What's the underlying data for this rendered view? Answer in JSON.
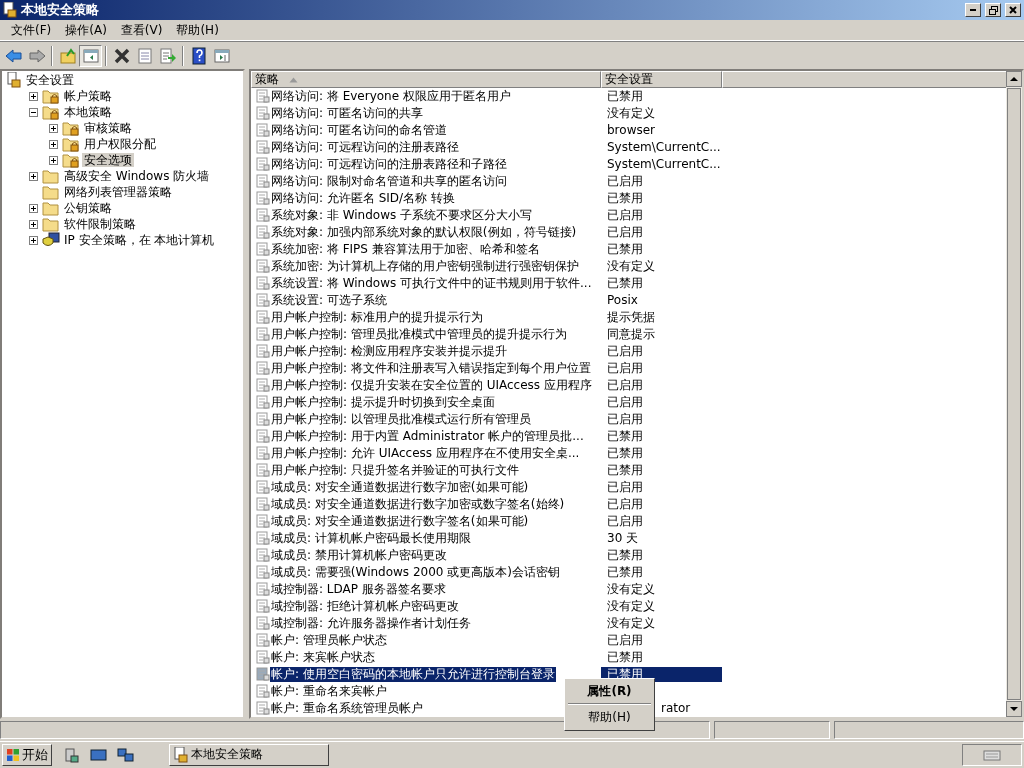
{
  "window": {
    "title": "本地安全策略"
  },
  "menu": [
    "文件(F)",
    "操作(A)",
    "查看(V)",
    "帮助(H)"
  ],
  "toolbar": [
    {
      "kind": "back"
    },
    {
      "kind": "forward"
    },
    {
      "kind": "sep"
    },
    {
      "kind": "up"
    },
    {
      "kind": "tree",
      "selected": true
    },
    {
      "kind": "sep"
    },
    {
      "kind": "delete"
    },
    {
      "kind": "properties"
    },
    {
      "kind": "export"
    },
    {
      "kind": "sep"
    },
    {
      "kind": "help"
    },
    {
      "kind": "pane"
    }
  ],
  "tree": [
    {
      "label": "安全设置",
      "kind": "root",
      "expandable": false,
      "selected": false,
      "children": [
        {
          "label": "帐户策略",
          "kind": "lockfolder",
          "expandable": true,
          "expanded": false,
          "selected": false
        },
        {
          "label": "本地策略",
          "kind": "lockfolder",
          "expandable": true,
          "expanded": true,
          "selected": false,
          "children": [
            {
              "label": "审核策略",
              "kind": "lockfolder",
              "expandable": true,
              "expanded": false,
              "selected": false
            },
            {
              "label": "用户权限分配",
              "kind": "lockfolder",
              "expandable": true,
              "expanded": false,
              "selected": false
            },
            {
              "label": "安全选项",
              "kind": "lockfolder",
              "expandable": true,
              "expanded": false,
              "selected": true
            }
          ]
        },
        {
          "label": "高级安全 Windows 防火墙",
          "kind": "folder",
          "expandable": true,
          "expanded": false,
          "selected": false
        },
        {
          "label": "网络列表管理器策略",
          "kind": "folder",
          "expandable": false,
          "selected": false
        },
        {
          "label": "公钥策略",
          "kind": "folder",
          "expandable": true,
          "expanded": false,
          "selected": false
        },
        {
          "label": "软件限制策略",
          "kind": "folder",
          "expandable": true,
          "expanded": false,
          "selected": false
        },
        {
          "label": "IP 安全策略，在 本地计算机",
          "kind": "computer",
          "expandable": true,
          "expanded": false,
          "selected": false
        }
      ]
    }
  ],
  "table": {
    "columns": [
      {
        "label": "策略",
        "sorted": true
      },
      {
        "label": "安全设置",
        "sorted": false
      }
    ],
    "rows": [
      {
        "policy": "网络访问: 将 Everyone 权限应用于匿名用户",
        "setting": "已禁用",
        "selected": false
      },
      {
        "policy": "网络访问: 可匿名访问的共享",
        "setting": "没有定义",
        "selected": false
      },
      {
        "policy": "网络访问: 可匿名访问的命名管道",
        "setting": "browser",
        "selected": false
      },
      {
        "policy": "网络访问: 可远程访问的注册表路径",
        "setting": "System\\CurrentC...",
        "selected": false
      },
      {
        "policy": "网络访问: 可远程访问的注册表路径和子路径",
        "setting": "System\\CurrentC...",
        "selected": false
      },
      {
        "policy": "网络访问: 限制对命名管道和共享的匿名访问",
        "setting": "已启用",
        "selected": false
      },
      {
        "policy": "网络访问: 允许匿名 SID/名称 转换",
        "setting": "已禁用",
        "selected": false
      },
      {
        "policy": "系统对象: 非 Windows 子系统不要求区分大小写",
        "setting": "已启用",
        "selected": false
      },
      {
        "policy": "系统对象: 加强内部系统对象的默认权限(例如，符号链接)",
        "setting": "已启用",
        "selected": false
      },
      {
        "policy": "系统加密: 将 FIPS 兼容算法用于加密、哈希和签名",
        "setting": "已禁用",
        "selected": false
      },
      {
        "policy": "系统加密: 为计算机上存储的用户密钥强制进行强密钥保护",
        "setting": "没有定义",
        "selected": false
      },
      {
        "policy": "系统设置: 将 Windows 可执行文件中的证书规则用于软件...",
        "setting": "已禁用",
        "selected": false
      },
      {
        "policy": "系统设置: 可选子系统",
        "setting": "Posix",
        "selected": false
      },
      {
        "policy": "用户帐户控制: 标准用户的提升提示行为",
        "setting": "提示凭据",
        "selected": false
      },
      {
        "policy": "用户帐户控制: 管理员批准模式中管理员的提升提示行为",
        "setting": "同意提示",
        "selected": false
      },
      {
        "policy": "用户帐户控制: 检测应用程序安装并提示提升",
        "setting": "已启用",
        "selected": false
      },
      {
        "policy": "用户帐户控制: 将文件和注册表写入错误指定到每个用户位置",
        "setting": "已启用",
        "selected": false
      },
      {
        "policy": "用户帐户控制: 仅提升安装在安全位置的 UIAccess 应用程序",
        "setting": "已启用",
        "selected": false
      },
      {
        "policy": "用户帐户控制: 提示提升时切换到安全桌面",
        "setting": "已启用",
        "selected": false
      },
      {
        "policy": "用户帐户控制: 以管理员批准模式运行所有管理员",
        "setting": "已启用",
        "selected": false
      },
      {
        "policy": "用户帐户控制: 用于内置 Administrator 帐户的管理员批...",
        "setting": "已禁用",
        "selected": false
      },
      {
        "policy": "用户帐户控制: 允许 UIAccess 应用程序在不使用安全桌...",
        "setting": "已禁用",
        "selected": false
      },
      {
        "policy": "用户帐户控制: 只提升签名并验证的可执行文件",
        "setting": "已禁用",
        "selected": false
      },
      {
        "policy": "域成员: 对安全通道数据进行数字加密(如果可能)",
        "setting": "已启用",
        "selected": false
      },
      {
        "policy": "域成员: 对安全通道数据进行数字加密或数字签名(始终)",
        "setting": "已启用",
        "selected": false
      },
      {
        "policy": "域成员: 对安全通道数据进行数字签名(如果可能)",
        "setting": "已启用",
        "selected": false
      },
      {
        "policy": "域成员: 计算机帐户密码最长使用期限",
        "setting": "30 天",
        "selected": false
      },
      {
        "policy": "域成员: 禁用计算机帐户密码更改",
        "setting": "已禁用",
        "selected": false
      },
      {
        "policy": "域成员: 需要强(Windows 2000 或更高版本)会话密钥",
        "setting": "已禁用",
        "selected": false
      },
      {
        "policy": "域控制器: LDAP 服务器签名要求",
        "setting": "没有定义",
        "selected": false
      },
      {
        "policy": "域控制器: 拒绝计算机帐户密码更改",
        "setting": "没有定义",
        "selected": false
      },
      {
        "policy": "域控制器: 允许服务器操作者计划任务",
        "setting": "没有定义",
        "selected": false
      },
      {
        "policy": "帐户: 管理员帐户状态",
        "setting": "已启用",
        "selected": false
      },
      {
        "policy": "帐户: 来宾帐户状态",
        "setting": "已禁用",
        "selected": false
      },
      {
        "policy": "帐户: 使用空白密码的本地帐户只允许进行控制台登录",
        "setting": "已禁用",
        "selected": true
      },
      {
        "policy": "帐户: 重命名来宾帐户",
        "selected": false
      },
      {
        "policy": "帐户: 重命名系统管理员帐户",
        "setting": "rator",
        "covered": true,
        "selected": false
      }
    ]
  },
  "context_menu": [
    {
      "label": "属性(R)",
      "default": true
    },
    {
      "label": "帮助(H)",
      "default": false
    }
  ],
  "taskbar": {
    "start": "开始",
    "tasks": [
      {
        "label": "本地安全策略",
        "selected": false
      }
    ]
  }
}
